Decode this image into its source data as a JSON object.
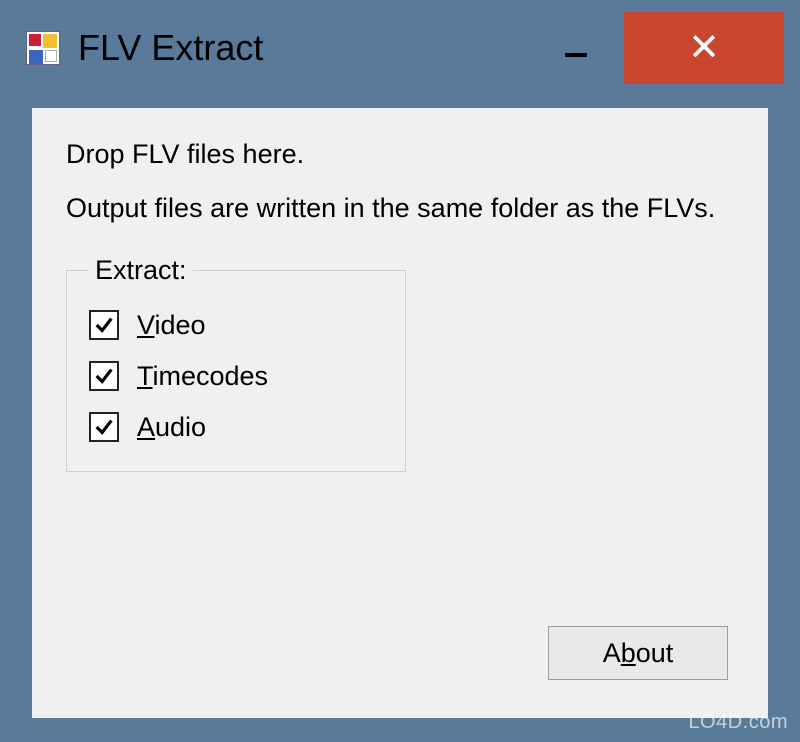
{
  "window": {
    "title": "FLV Extract"
  },
  "titlebar": {
    "minimize_tooltip": "Minimize",
    "close_tooltip": "Close"
  },
  "main": {
    "instruction_line1": "Drop FLV files here.",
    "instruction_line2": "Output files are written in the same folder as the FLVs."
  },
  "extract": {
    "legend": "Extract:",
    "options": [
      {
        "label_pre": "",
        "label_ul": "V",
        "label_post": "ideo",
        "checked": true
      },
      {
        "label_pre": "",
        "label_ul": "T",
        "label_post": "imecodes",
        "checked": true
      },
      {
        "label_pre": "",
        "label_ul": "A",
        "label_post": "udio",
        "checked": true
      }
    ]
  },
  "buttons": {
    "about_pre": "A",
    "about_ul": "b",
    "about_post": "out"
  },
  "watermark": "LO4D.com"
}
